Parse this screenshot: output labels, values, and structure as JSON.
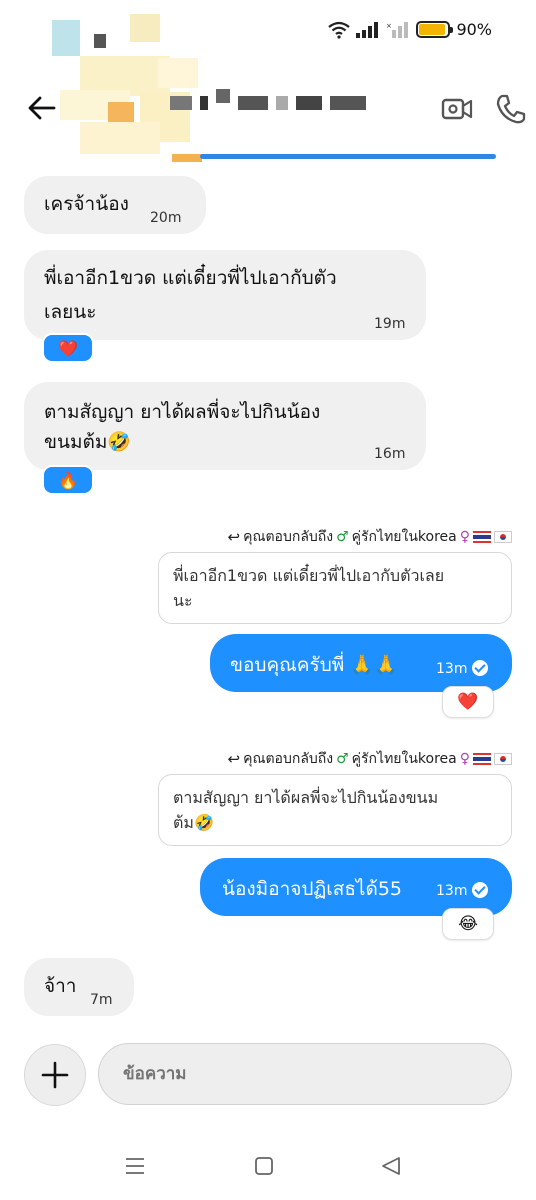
{
  "status_bar": {
    "battery": "90%",
    "battery_level": 0.9
  },
  "header": {
    "name_redacted": true
  },
  "messages": [
    {
      "dir": "in",
      "text": "เครจ้าน้อง",
      "time": "20m"
    },
    {
      "dir": "in",
      "text_line1": "พี่เอาอีก1ขวด แต่เดี๋ยวพี่ไปเอากับตัว",
      "text_line2": "เลยนะ",
      "time": "19m",
      "reaction": "❤️"
    },
    {
      "dir": "in",
      "text_line1": "ตามสัญญา ยาได้ผลพี่จะไปกินน้อง",
      "text_line2": "ขนมต้ม🤣",
      "time": "16m",
      "reaction": "🔥"
    },
    {
      "dir": "out",
      "reply_label": "คุณตอบกลับถึง",
      "reply_to": "คู่รักไทยในkorea",
      "quoted_line1": "พี่เอาอีก1ขวด แต่เดี๋ยวพี่ไปเอากับตัวเลย",
      "quoted_line2": "นะ",
      "text": "ขอบคุณครับพี่ 🙏🙏",
      "time": "13m",
      "reaction": "❤️"
    },
    {
      "dir": "out",
      "reply_label": "คุณตอบกลับถึง",
      "reply_to": "คู่รักไทยในkorea",
      "quoted_line1": "ตามสัญญา ยาได้ผลพี่จะไปกินน้องขนม",
      "quoted_line2": "ต้ม🤣",
      "text": "น้องมิอาจปฏิเสธได้55",
      "time": "13m",
      "reaction": "😂"
    },
    {
      "dir": "in",
      "text": "จ้าา",
      "time": "7m"
    }
  ],
  "composer": {
    "placeholder": "ข้อความ"
  },
  "colors": {
    "accent": "#1e90ff",
    "incoming_bg": "#f0f0f0"
  },
  "icons": [
    "wifi-icon",
    "signal-icon",
    "battery-icon",
    "back-arrow-icon",
    "video-call-icon",
    "phone-icon",
    "check-icon",
    "plus-icon",
    "menu-nav-icon",
    "home-nav-icon",
    "back-nav-icon"
  ]
}
